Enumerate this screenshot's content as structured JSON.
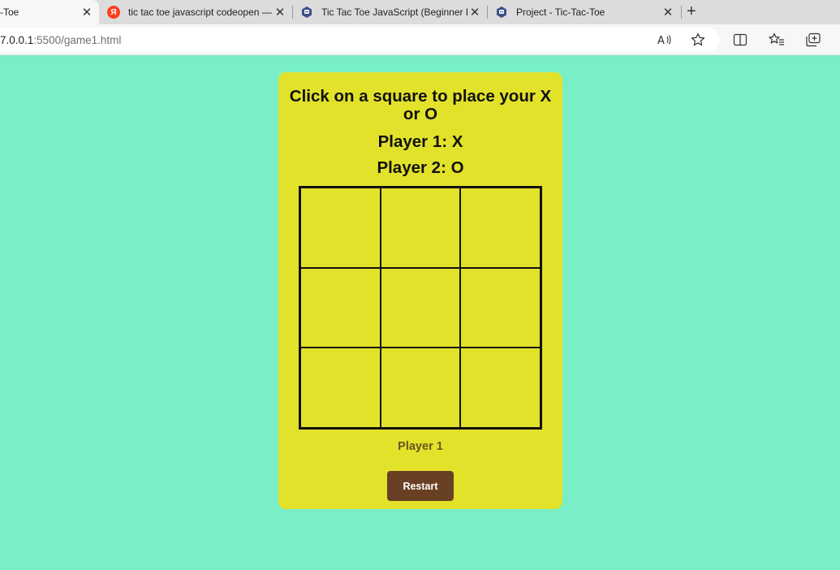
{
  "browser": {
    "tabs": [
      {
        "title": "-Toe",
        "favicon": "page-icon",
        "active": true
      },
      {
        "title": "tic tac toe javascript codeopen —",
        "favicon": "yandex-icon",
        "active": false
      },
      {
        "title": "Tic Tac Toe JavaScript (Beginner F",
        "favicon": "project-icon",
        "active": false
      },
      {
        "title": "Project - Tic-Tac-Toe",
        "favicon": "project-icon",
        "active": false
      }
    ],
    "new_tab_glyph": "+",
    "close_glyph": "✕",
    "url_host": "7.0.0.1",
    "url_rest": ":5500/game1.html",
    "yandex_letter": "Я"
  },
  "game": {
    "instruction": "Click on a square to place your X or O",
    "player1": "Player 1: X",
    "player2": "Player 2: O",
    "cells": [
      "",
      "",
      "",
      "",
      "",
      "",
      "",
      "",
      ""
    ],
    "status": "Player 1",
    "restart_label": "Restart"
  },
  "colors": {
    "page_background": "#79efc8",
    "card": "#e3e22a",
    "restart_button": "#6a4024",
    "status_text": "#6b5320"
  }
}
